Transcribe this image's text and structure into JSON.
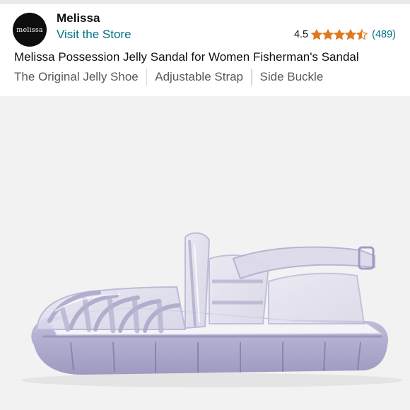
{
  "store": {
    "logo_text": "melissa",
    "brand_name": "Melissa",
    "visit_store_label": "Visit the Store"
  },
  "rating": {
    "value": "4.5",
    "stars_out_of_5": 4.5,
    "review_count": "(489)",
    "star_color": "#de7921"
  },
  "product": {
    "title": "Melissa Possession Jelly Sandal for Women Fisherman's Sandal",
    "features": [
      "The Original Jelly Shoe",
      "Adjustable Strap",
      "Side Buckle"
    ]
  },
  "image": {
    "icon": "jelly-sandal-image",
    "background_color": "#f2f2f2"
  },
  "colors": {
    "link": "#007185",
    "muted_text": "#565959",
    "divider": "#d5d9d9"
  }
}
